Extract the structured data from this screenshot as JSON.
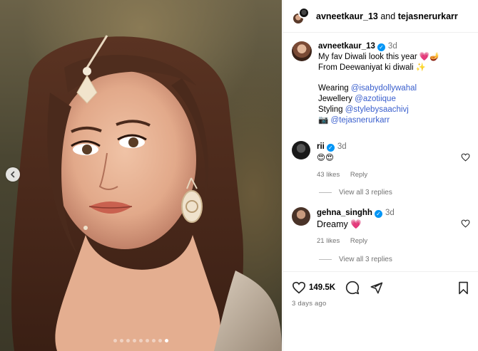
{
  "media": {
    "carousel_total": 9,
    "carousel_active_index": 8
  },
  "header": {
    "author": "avneetkaur_13",
    "and_text": "and",
    "collaborator": "tejasnerurkarr"
  },
  "caption": {
    "username": "avneetkaur_13",
    "time": "3d",
    "line1": "My fav Diwali look this year 💗🪔",
    "line2": "From Deewaniyat ki diwali ✨",
    "wearing_label": "Wearing",
    "wearing_handle": "@isabydollywahal",
    "jewellery_label": "Jewellery",
    "jewellery_handle": "@azotiique",
    "styling_label": "Styling",
    "styling_handle": "@stylebysaachivj",
    "photo_prefix": "📷",
    "photo_handle": "@tejasnerurkarr"
  },
  "comments": [
    {
      "username": "rii",
      "time": "3d",
      "text": "😍😍",
      "likes": "43 likes",
      "reply": "Reply",
      "view_replies": "View all 3 replies"
    },
    {
      "username": "gehna_singhh",
      "time": "3d",
      "text": "Dreamy 💗",
      "likes": "21 likes",
      "reply": "Reply",
      "view_replies": "View all 3 replies"
    }
  ],
  "actions": {
    "like_count": "149.5K",
    "posted": "3 days ago"
  },
  "icons": {
    "prev": "chevron-left-icon",
    "like": "heart-icon",
    "comment": "comment-icon",
    "share": "share-icon",
    "save": "bookmark-icon"
  },
  "colors": {
    "verified": "#0095f6",
    "link": "#3a5fcd",
    "muted": "#737373"
  }
}
